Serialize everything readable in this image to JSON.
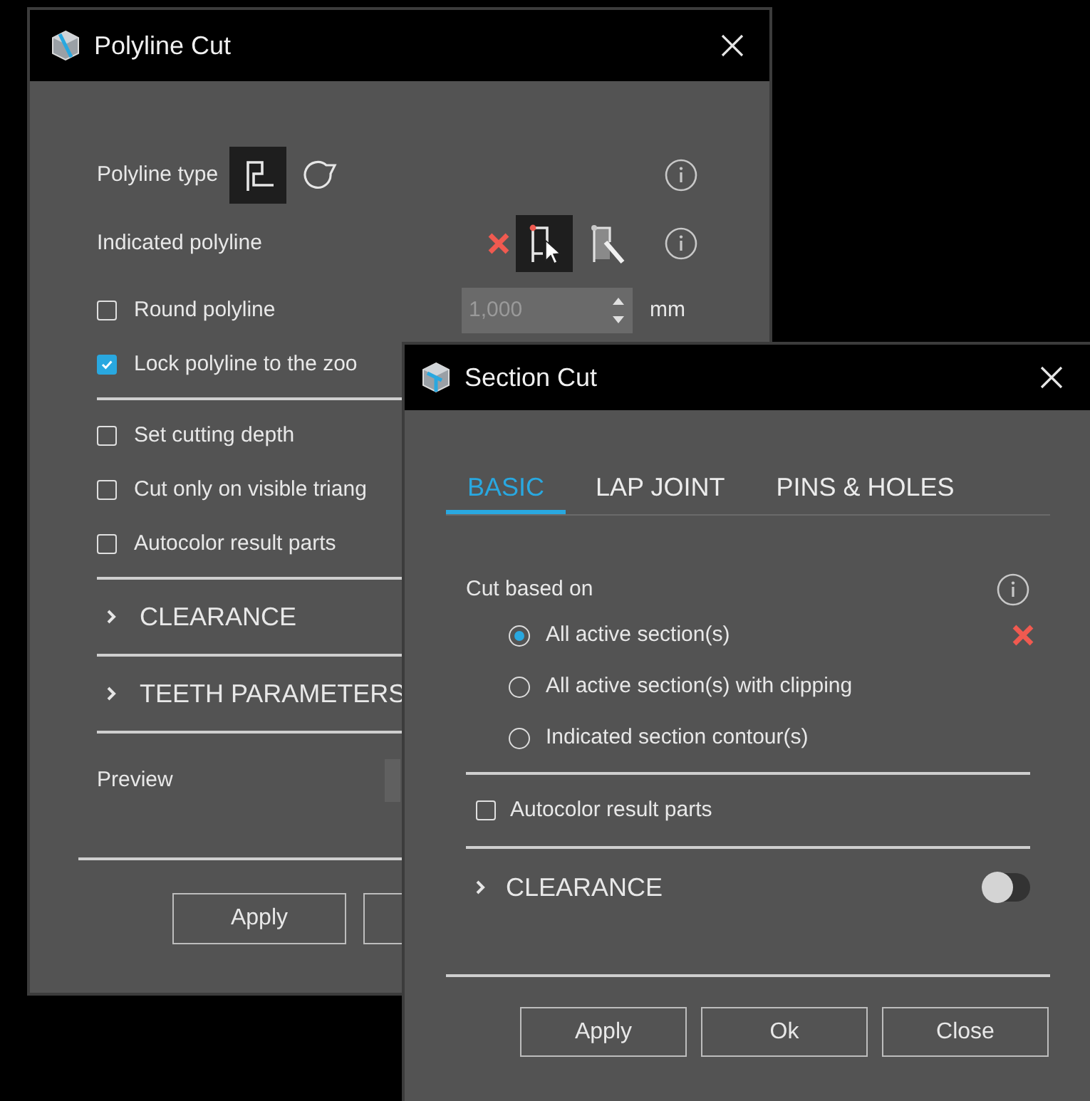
{
  "polyline_cut": {
    "title": "Polyline Cut",
    "polyline_type": {
      "label": "Polyline type",
      "options": [
        {
          "selected": true
        },
        {
          "selected": false
        }
      ]
    },
    "indicated_polyline": {
      "label": "Indicated polyline",
      "tools": [
        {
          "selected": true
        },
        {
          "selected": false
        }
      ]
    },
    "option_groups": [
      [
        {
          "label": "Round polyline",
          "checked": false,
          "value": "1,000",
          "unit": "mm"
        },
        {
          "label": "Lock polyline to the zoo",
          "checked": true
        }
      ],
      [
        {
          "label": "Set cutting depth",
          "checked": false
        },
        {
          "label": "Cut only on visible triang",
          "checked": false
        },
        {
          "label": "Autocolor result parts",
          "checked": false
        }
      ]
    ],
    "sections": [
      {
        "label": "CLEARANCE",
        "expanded": false
      },
      {
        "label": "TEETH PARAMETERS",
        "expanded": false
      }
    ],
    "preview": {
      "label": "Preview"
    },
    "buttons": [
      "Apply"
    ]
  },
  "section_cut": {
    "title": "Section Cut",
    "tabs": [
      {
        "label": "BASIC",
        "selected": true
      },
      {
        "label": "LAP JOINT",
        "selected": false
      },
      {
        "label": "PINS & HOLES",
        "selected": false
      }
    ],
    "cut_based_on": {
      "label": "Cut based on",
      "options": [
        {
          "label": "All active section(s)",
          "selected": true
        },
        {
          "label": "All active section(s) with clipping",
          "selected": false
        },
        {
          "label": "Indicated section contour(s)",
          "selected": false
        }
      ]
    },
    "autocolor": {
      "label": "Autocolor result parts",
      "checked": false
    },
    "clearance": {
      "label": "CLEARANCE",
      "expanded": false,
      "on": false
    },
    "buttons": [
      "Apply",
      "Ok",
      "Close"
    ]
  }
}
